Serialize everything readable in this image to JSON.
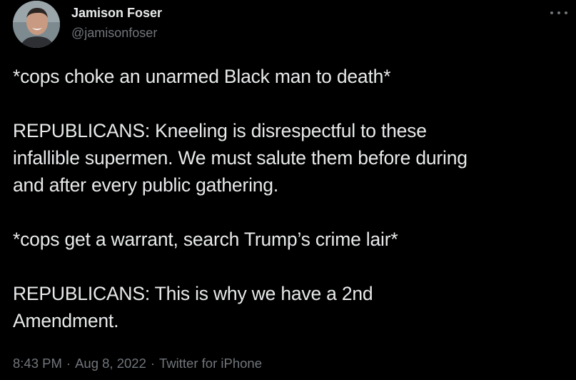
{
  "author": {
    "display_name": "Jamison Foser",
    "handle": "@jamisonfoser",
    "avatar_icon": "profile-photo"
  },
  "more_icon": "more-dots-icon",
  "tweet": {
    "lines": [
      "*cops choke an unarmed Black man to death*",
      "",
      "REPUBLICANS: Kneeling is disrespectful to these",
      "infallible supermen. We must salute them before during",
      "and after every public gathering.",
      "",
      "*cops get a warrant, search Trump’s crime lair*",
      "",
      "REPUBLICANS: This is why we have a 2nd",
      "Amendment."
    ]
  },
  "meta": {
    "time": "8:43 PM",
    "separator": "·",
    "date": "Aug 8, 2022",
    "source": "Twitter for iPhone"
  },
  "colors": {
    "background": "#000000",
    "text": "#e7e9ea",
    "secondary": "#71767b"
  }
}
